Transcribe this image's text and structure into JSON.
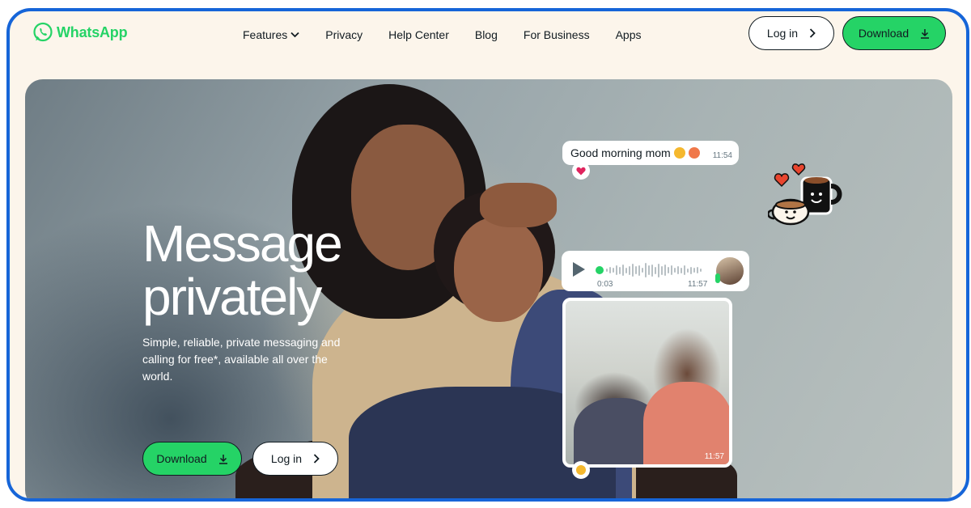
{
  "header": {
    "logo_text": "WhatsApp",
    "nav": [
      {
        "label": "Features",
        "has_dropdown": true
      },
      {
        "label": "Privacy"
      },
      {
        "label": "Help Center"
      },
      {
        "label": "Blog"
      },
      {
        "label": "For Business"
      },
      {
        "label": "Apps"
      }
    ],
    "login_label": "Log in",
    "download_label": "Download"
  },
  "hero": {
    "headline_line1": "Message",
    "headline_line2": "privately",
    "subtitle": "Simple, reliable, private messaging and calling for free*, available all over the world.",
    "download_label": "Download",
    "login_label": "Log in"
  },
  "chat": {
    "message_text": "Good morning mom",
    "message_time": "11:54",
    "voice_elapsed": "0:03",
    "voice_time": "11:57",
    "photo_time": "11:57"
  },
  "colors": {
    "brand_green": "#25d366",
    "frame_border": "#1665d8",
    "page_background": "#fcf5eb",
    "text": "#111b21"
  },
  "icons": [
    "whatsapp-logo-icon",
    "chevron-down-icon",
    "chevron-right-icon",
    "download-icon",
    "play-icon",
    "mic-icon",
    "heart-icon"
  ]
}
